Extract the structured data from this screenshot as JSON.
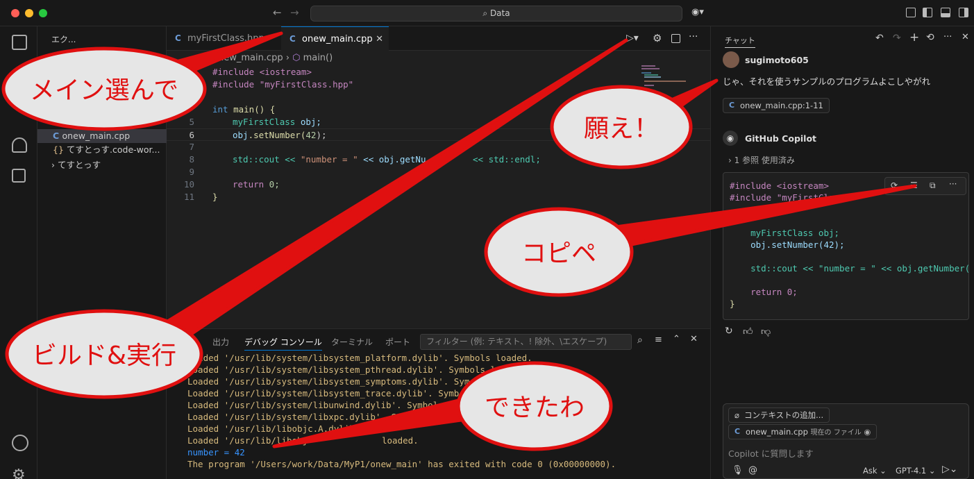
{
  "titlebar": {
    "search_label": "Data",
    "search_icon": "search-icon"
  },
  "sidebar": {
    "header": "エク...",
    "items": [
      {
        "label": "onew_main.cpp",
        "active": true
      },
      {
        "label": "てすとっす.code-wor..."
      },
      {
        "label": "てすとっす"
      }
    ]
  },
  "editor": {
    "tabs": [
      {
        "label": "myFirstClass.hpp",
        "active": false
      },
      {
        "label": "onew_main.cpp",
        "active": true
      }
    ],
    "breadcrumb": {
      "file": "onew_main.cpp",
      "symbol": "main()"
    },
    "line_numbers": [
      "5",
      "6",
      "7",
      "8",
      "9",
      "10",
      "11"
    ]
  },
  "code": {
    "inc1": "#include <iostream>",
    "inc2": "#include \"myFirstClass.hpp\"",
    "l4a": "int",
    "l4b": " main() {",
    "l5a": "myFirstClass",
    "l5b": " obj;",
    "l6a": "obj",
    "l6b": ".setNumber(",
    "l6c": "42",
    "l6d": ");",
    "l8a": "std::cout << ",
    "l8b": "\"number = \"",
    "l8c": " << obj.getNu",
    "l8d": " << std::endl;",
    "l10a": "return",
    "l10b": " 0;",
    "l11": "}"
  },
  "panel": {
    "tabs": [
      "出力",
      "デバッグ コンソール",
      "ターミナル",
      "ポート"
    ],
    "filter_placeholder": "フィルター (例: テキスト、! 除外、\\エスケープ)",
    "lines": [
      "Loaded '/usr/lib/system/libsystem_platform.dylib'. Symbols loaded.",
      "Loaded '/usr/lib/system/libsystem_pthread.dylib'. Symbols lo",
      "Loaded '/usr/lib/system/libsystem_symptoms.dylib'. Sym",
      "Loaded '/usr/lib/system/libsystem_trace.dylib'. Symb",
      "Loaded '/usr/lib/system/libunwind.dylib'. Symbols l",
      "Loaded '/usr/lib/system/libxpc.dylib'. Symbols",
      "Loaded '/usr/lib/libobjc.A.dylib'.",
      "Loaded '/usr/lib/libobj",
      "number = 42",
      "The program '/Users/work/Data/MyP1/onew_main' has exited with code 0 (0x00000000)."
    ],
    "tail_fragment": "loaded."
  },
  "chat": {
    "header": "チャット",
    "user": {
      "name": "sugimoto605",
      "message": "じゃ、それを使うサンプルのプログラムよこしやがれ",
      "ref": "onew_main.cpp:1-11"
    },
    "assistant": {
      "name": "GitHub Copilot",
      "refs_summary": "1 参照 使用済み"
    },
    "code_lines": [
      "#include <iostream>",
      "#include \"myFirstCla",
      "",
      "    myFirstClass obj;",
      "    obj.setNumber(42);",
      "",
      "    std::cout << \"number = \" << obj.getNumber()",
      "",
      "    return 0;",
      "}"
    ],
    "input": {
      "add_context": "コンテキストの追加...",
      "current_file": "onew_main.cpp",
      "current_file_note": "現在の ファイル",
      "placeholder": "Copilot に質問します",
      "mode": "Ask",
      "model": "GPT-4.1"
    }
  },
  "annotations": [
    {
      "text": "メイン選んで"
    },
    {
      "text": "願え！"
    },
    {
      "text": "コピペ"
    },
    {
      "text": "ビルド&実行"
    },
    {
      "text": "できたわ"
    }
  ],
  "colors": {
    "annotation_red": "#e01010",
    "bubble_fill": "#e6e6e6",
    "debug_text": "#d7ba7d",
    "debug_blue": "#3794ff"
  }
}
